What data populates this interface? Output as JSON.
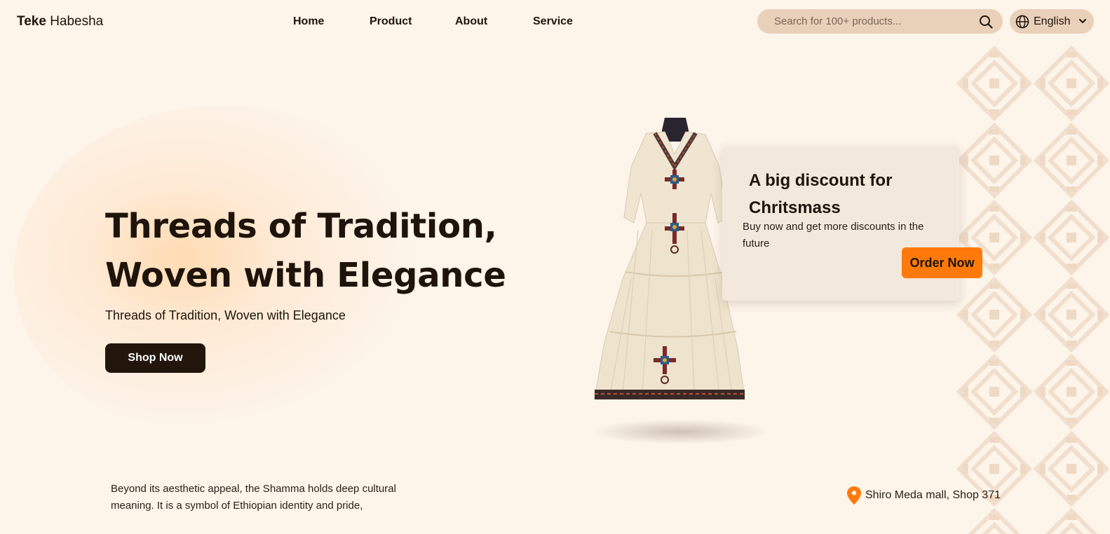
{
  "brand": {
    "bold": "Teke",
    "light": "Habesha"
  },
  "nav": [
    {
      "label": "Home"
    },
    {
      "label": "Product"
    },
    {
      "label": "About"
    },
    {
      "label": "Service"
    }
  ],
  "search": {
    "placeholder": "Search for 100+ products...",
    "icon": "search-icon"
  },
  "language": {
    "selected": "English",
    "icon": "globe-icon"
  },
  "hero": {
    "title_line1": "Threads of Tradition,",
    "title_line2": "Woven with Elegance",
    "subtitle": "Threads of Tradition, Woven with Elegance",
    "cta": "Shop Now"
  },
  "promo": {
    "title": "A big discount for Chritsmass",
    "text": "Buy now and get more discounts in the future",
    "cta": "Order Now"
  },
  "about": {
    "text": "Beyond its aesthetic appeal, the Shamma holds deep cultural meaning. It is a symbol of Ethiopian identity and pride,"
  },
  "location": {
    "label": "Shiro Meda mall, Shop 371",
    "icon": "location-pin-icon"
  },
  "colors": {
    "background": "#fdf4ea",
    "accent": "#ff7a0a",
    "dark": "#22150b",
    "search_bg": "#e9d0b9"
  }
}
